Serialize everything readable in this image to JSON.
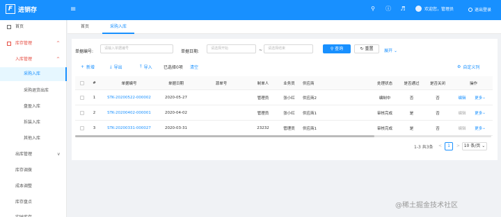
{
  "header": {
    "app_name": "进销存",
    "logo_letter": "F",
    "collapse_icon": "≡",
    "icons": [
      "search-icon",
      "help-icon",
      "bell-icon"
    ],
    "user_greeting": "欢迎您，管理员",
    "logout": "退出登录",
    "accent": "#1890ff"
  },
  "sidebar": {
    "items": [
      {
        "label": "首页"
      },
      {
        "label": "库存管理",
        "arrow": "^"
      },
      {
        "label": "入库管理",
        "arrow": "^"
      },
      {
        "label": "采购入库"
      },
      {
        "label": "采购退货出库"
      },
      {
        "label": "盘盈入库"
      },
      {
        "label": "拆装入库"
      },
      {
        "label": "其他入库"
      },
      {
        "label": "出库管理",
        "arrow": "v"
      },
      {
        "label": "库存调拨"
      },
      {
        "label": "成本调整"
      },
      {
        "label": "库存盘点"
      },
      {
        "label": "实时库存"
      }
    ]
  },
  "tabs": [
    {
      "label": "首页"
    },
    {
      "label": "采购入库"
    }
  ],
  "filters": {
    "order_no_label": "单据编号:",
    "order_no_placeholder": "请输入单据编号",
    "date_label": "单据日期:",
    "date_start_placeholder": "请选择开始",
    "date_sep": "~",
    "date_end_placeholder": "请选择结束",
    "search": "查询",
    "reset": "重置",
    "expand": "展开"
  },
  "toolbar": {
    "add": "新增",
    "export": "导出",
    "import": "导入",
    "selected": "已选择0项",
    "clear": "清空",
    "custom_columns": "自定义列"
  },
  "table": {
    "columns": [
      "#",
      "单据编号",
      "单据日期",
      "源单号",
      "制单人",
      "业务员",
      "供应商",
      "处理状态",
      "是否通过",
      "是否关闭",
      "操作"
    ],
    "rows": [
      {
        "index": "1",
        "order_no": "STK-20200522-000002",
        "date": "2020-05-27",
        "source": "",
        "creator": "管理员",
        "salesman": "张小红",
        "supplier": "供应商2",
        "status": "编制中",
        "passed": "否",
        "closed": "否",
        "action1": "编辑",
        "action2": "更多"
      },
      {
        "index": "2",
        "order_no": "STK-20200402-000001",
        "date": "2020-04-02",
        "source": "",
        "creator": "管理员",
        "salesman": "张小红",
        "supplier": "供应商1",
        "status": "审核完成",
        "passed": "是",
        "closed": "否",
        "action1": "编辑",
        "action2": "更多"
      },
      {
        "index": "3",
        "order_no": "STK-20200331-000027",
        "date": "2020-03-31",
        "source": "",
        "creator": "23232",
        "salesman": "管理员",
        "supplier": "供应商1",
        "status": "审核完成",
        "passed": "是",
        "closed": "否",
        "action1": "编辑",
        "action2": "更多"
      }
    ]
  },
  "pagination": {
    "summary": "1-3 共3条",
    "prev": "<",
    "current": "1",
    "next": ">",
    "page_size": "10 条/页"
  },
  "watermark": "@稀土掘金技术社区"
}
